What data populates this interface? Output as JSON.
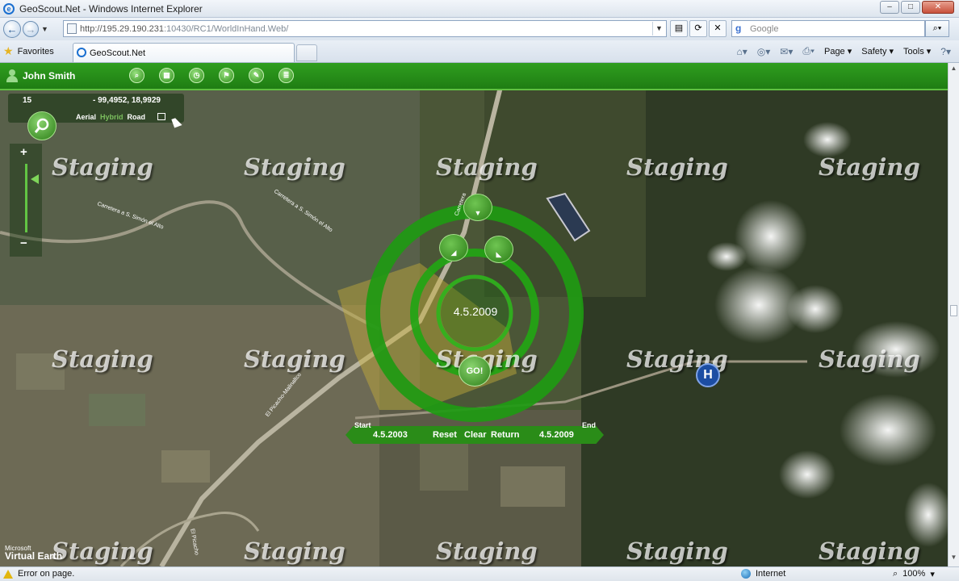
{
  "window": {
    "title": "GeoScout.Net - Windows Internet Explorer"
  },
  "address": {
    "url_host": "http://195.29.190.231",
    "url_rest": ":10430/RC1/WorldInHand.Web/"
  },
  "search": {
    "placeholder": "Google"
  },
  "favorites": {
    "label": "Favorites"
  },
  "tab": {
    "title": "GeoScout.Net"
  },
  "commands": {
    "page": "Page",
    "safety": "Safety",
    "tools": "Tools"
  },
  "app": {
    "user_name": "John Smith",
    "zoom_level": "15",
    "coordinates": "- 99,4952, 18,9929",
    "layers": {
      "aerial": "Aerial",
      "hybrid": "Hybrid",
      "road": "Road"
    },
    "watermark": "Staging",
    "brand_ms": "Microsoft",
    "brand_ve": "Virtual Earth",
    "hospital_marker": "H"
  },
  "time_control": {
    "current_date": "4.5.2009",
    "go_label": "GO!",
    "start_label": "Start",
    "end_label": "End",
    "start_date": "4.5.2003",
    "end_date": "4.5.2009",
    "reset_label": "Reset",
    "clear_label": "Clear",
    "return_label": "Return"
  },
  "map_labels": {
    "road1": "Carretera a S. Simón el Alto",
    "road2": "Carretera a S. Simón el Alto",
    "road3": "El Picacho-Malinaltco",
    "road4": "El Picacho",
    "road5": "Carretera"
  },
  "status": {
    "error": "Error on page.",
    "zone": "Internet",
    "zoom": "100%"
  },
  "colors": {
    "app_green": "#2a8c18",
    "ring_green": "#1e9a12",
    "hospital_blue": "#1c4da3"
  }
}
